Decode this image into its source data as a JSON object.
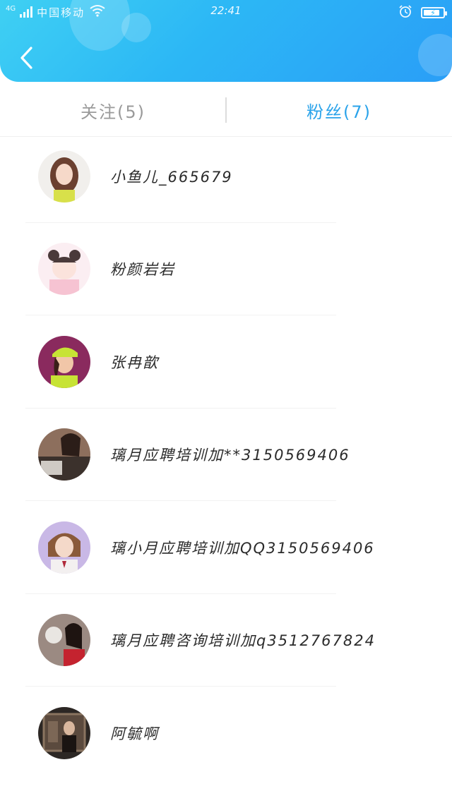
{
  "status_bar": {
    "network": "4G",
    "carrier": "中国移动",
    "time": "22:41",
    "icons": [
      "signal-icon",
      "wifi-icon",
      "alarm-icon",
      "battery-charging-icon"
    ],
    "battery_level": 0.85
  },
  "header": {
    "back_icon": "chevron-left-icon",
    "gradient": [
      "#3fd0f3",
      "#2a9ef7"
    ]
  },
  "tabs": [
    {
      "label": "关注(5)",
      "active": false
    },
    {
      "label": "粉丝(7)",
      "active": true
    }
  ],
  "accent_color": "#2aa3ea",
  "fans": [
    {
      "name": "小鱼儿_665679",
      "avatar": "avatar-image"
    },
    {
      "name": "粉颜岩岩",
      "avatar": "avatar-image"
    },
    {
      "name": "张冉歆",
      "avatar": "avatar-image"
    },
    {
      "name": "璃月应聘培训加**3150569406",
      "avatar": "avatar-image"
    },
    {
      "name": "璃小月应聘培训加QQ3150569406",
      "avatar": "avatar-image"
    },
    {
      "name": "璃月应聘咨询培训加q3512767824",
      "avatar": "avatar-image"
    },
    {
      "name": "阿毓啊",
      "avatar": "avatar-image"
    }
  ]
}
